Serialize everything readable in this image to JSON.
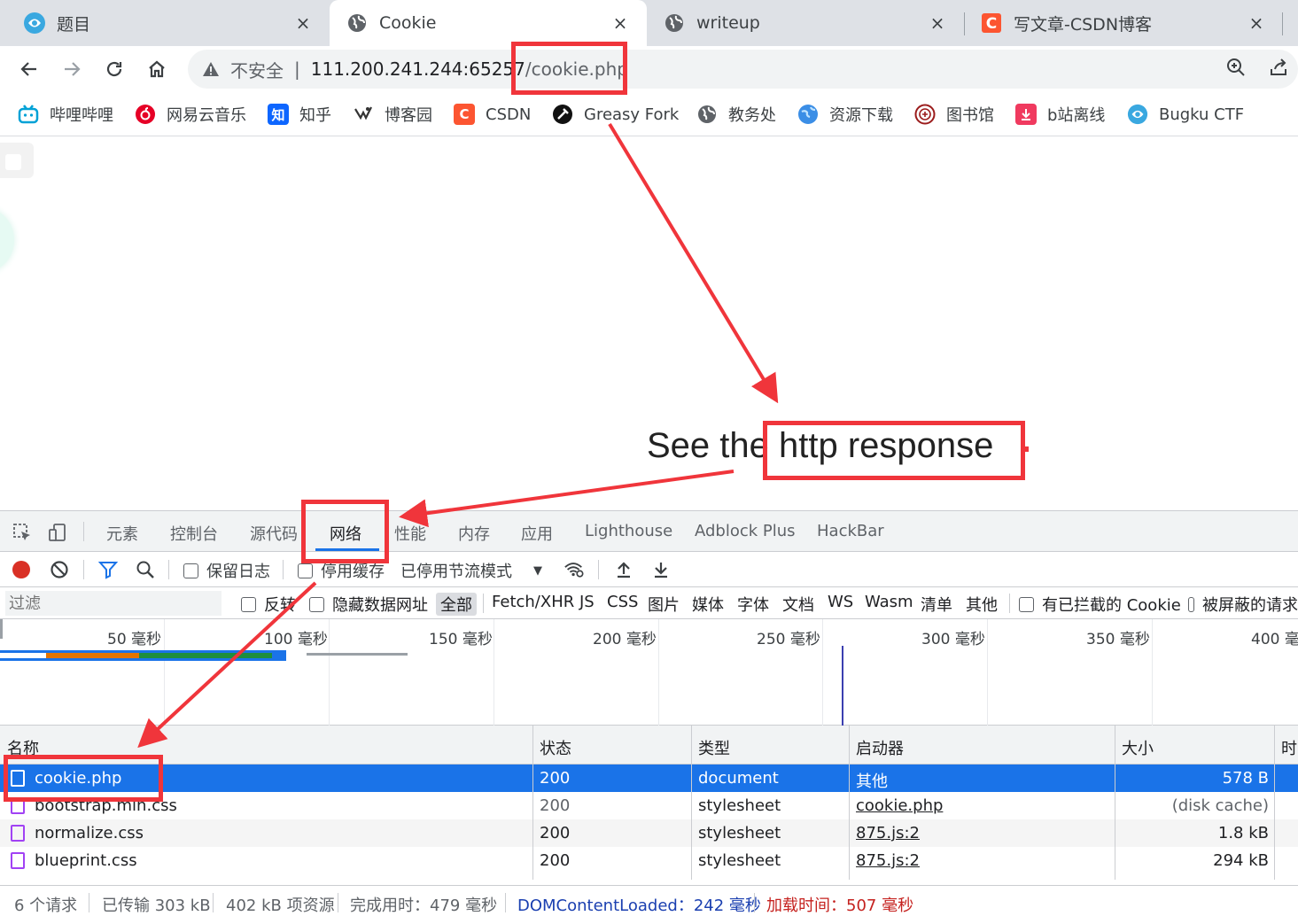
{
  "tabs": [
    {
      "title": "题目",
      "close": "×"
    },
    {
      "title": "Cookie",
      "close": "×"
    },
    {
      "title": "writeup",
      "close": "×"
    },
    {
      "title": "写文章-CSDN博客",
      "close": "×"
    }
  ],
  "omnibox": {
    "insecure_label": "不安全",
    "separator": "|",
    "host": "111.200.241.244:65257",
    "path": "/cookie.php"
  },
  "bookmarks": [
    {
      "label": "哔哩哔哩"
    },
    {
      "label": "网易云音乐"
    },
    {
      "label": "知乎",
      "glyph": "知"
    },
    {
      "label": "博客园"
    },
    {
      "label": "CSDN",
      "glyph": "C"
    },
    {
      "label": "Greasy Fork"
    },
    {
      "label": "教务处"
    },
    {
      "label": "资源下载"
    },
    {
      "label": "图书馆"
    },
    {
      "label": "b站离线"
    },
    {
      "label": "Bugku CTF"
    }
  ],
  "page": {
    "message": "See the http response"
  },
  "devtools": {
    "tabs": [
      "元素",
      "控制台",
      "源代码",
      "网络",
      "性能",
      "内存",
      "应用",
      "Lighthouse",
      "Adblock Plus",
      "HackBar"
    ],
    "active_tab": "网络",
    "toolbar": {
      "preserve_log": "保留日志",
      "disable_cache": "停用缓存",
      "throttling": "已停用节流模式"
    },
    "filter": {
      "placeholder": "过滤",
      "invert": "反转",
      "hide_data_urls": "隐藏数据网址",
      "types": [
        "全部",
        "Fetch/XHR",
        "JS",
        "CSS",
        "图片",
        "媒体",
        "字体",
        "文档",
        "WS",
        "Wasm",
        "清单",
        "其他"
      ],
      "blocked_cookies": "有已拦截的 Cookie",
      "blocked_requests": "被屏蔽的请求"
    },
    "timeline_labels": [
      "50 毫秒",
      "100 毫秒",
      "150 毫秒",
      "200 毫秒",
      "250 毫秒",
      "300 毫秒",
      "350 毫秒",
      "400 毫秒"
    ],
    "columns": [
      "名称",
      "状态",
      "类型",
      "启动器",
      "大小",
      "时间"
    ],
    "rows": [
      {
        "name": "cookie.php",
        "status": "200",
        "type": "document",
        "initiator": "其他",
        "size": "578 B"
      },
      {
        "name": "bootstrap.min.css",
        "status": "200",
        "type": "stylesheet",
        "initiator": "cookie.php",
        "size": "(disk cache)"
      },
      {
        "name": "normalize.css",
        "status": "200",
        "type": "stylesheet",
        "initiator": "875.js:2",
        "size": "1.8 kB"
      },
      {
        "name": "blueprint.css",
        "status": "200",
        "type": "stylesheet",
        "initiator": "875.js:2",
        "size": "294 kB"
      }
    ],
    "status": {
      "requests": "6 个请求",
      "transferred": "已传输 303 kB",
      "resources": "402 kB 项资源",
      "finish": "完成用时：479 毫秒",
      "dcl": "DOMContentLoaded：242 毫秒",
      "load": "加载时间：507 毫秒"
    }
  },
  "colors": {
    "accent": "#1a73e8",
    "annotation": "#f0353b",
    "record": "#d93025"
  }
}
